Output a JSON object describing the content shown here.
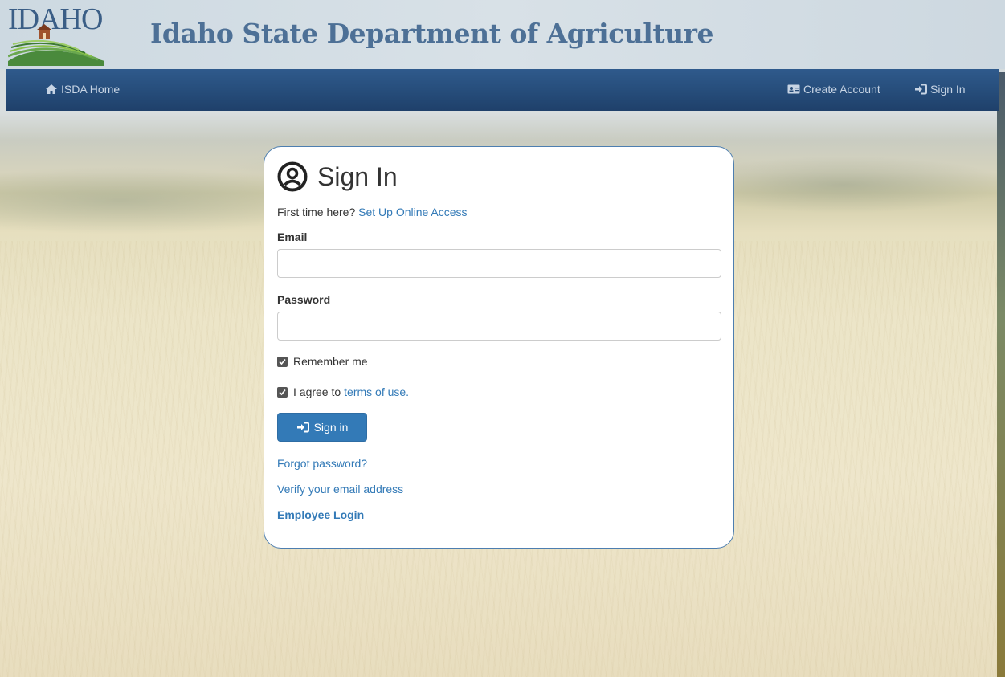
{
  "header": {
    "logo_text": "IDAHO",
    "site_title": "Idaho State Department of Agriculture"
  },
  "navbar": {
    "home_label": "ISDA Home",
    "create_account_label": "Create Account",
    "sign_in_label": "Sign In"
  },
  "signin_card": {
    "title": "Sign In",
    "first_time_text": "First time here?",
    "setup_link": "Set Up Online Access",
    "email_label": "Email",
    "email_value": "",
    "password_label": "Password",
    "password_value": "",
    "remember_me_label": "Remember me",
    "remember_me_checked": true,
    "agree_prefix": "I agree to",
    "terms_link": "terms of use.",
    "agree_checked": true,
    "sign_in_button": "Sign in",
    "forgot_password_link": "Forgot password?",
    "verify_email_link": "Verify your email address",
    "employee_login_link": "Employee Login"
  },
  "icons": {
    "home": "home-icon",
    "create_account": "id-card-icon",
    "sign_in": "sign-in-icon",
    "user": "user-circle-icon",
    "checkbox": "check-icon"
  },
  "colors": {
    "navbar": "#254b78",
    "link": "#337ab7",
    "button": "#337ab7",
    "title": "#4d7096"
  }
}
